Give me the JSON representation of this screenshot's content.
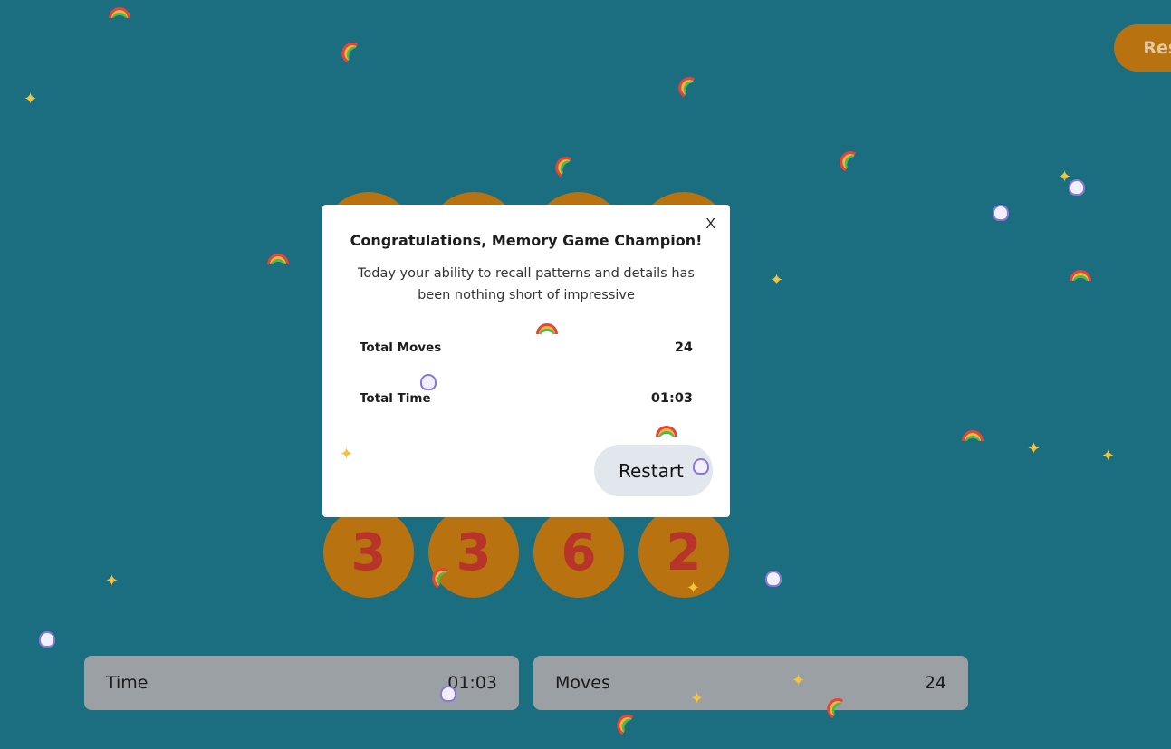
{
  "header": {
    "restart_label": "Restart"
  },
  "board": {
    "cards": [
      "3",
      "3",
      "6",
      "2"
    ]
  },
  "stats": {
    "time_label": "Time",
    "time_value": "01:03",
    "moves_label": "Moves",
    "moves_value": "24"
  },
  "modal": {
    "close_label": "X",
    "title": "Congratulations, Memory Game Champion!",
    "message": "Today your ability to recall patterns and details has been nothing short of impressive",
    "total_moves_label": "Total Moves",
    "total_moves_value": "24",
    "total_time_label": "Total Time",
    "total_time_value": "01:03",
    "restart_label": "Restart"
  },
  "colors": {
    "background": "#1b6e80",
    "accent": "#b8720f",
    "card_text": "#b8342a",
    "stat_bar": "#9ba0a4"
  },
  "decorations": [
    "rainbow-icon",
    "sparkle-icon",
    "unicorn-icon"
  ]
}
